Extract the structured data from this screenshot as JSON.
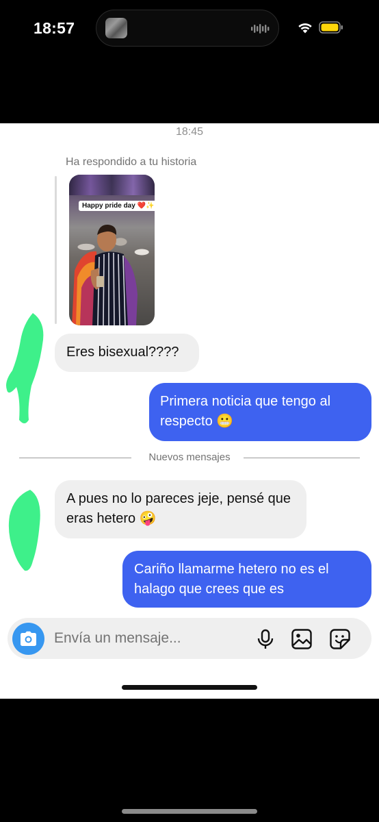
{
  "status_bar": {
    "time": "18:57"
  },
  "chat": {
    "timestamp": "18:45",
    "story_reply": {
      "caption": "Ha respondido a tu historia",
      "sticker_text": "Happy pride day ❤️✨"
    },
    "messages": [
      {
        "direction": "incoming",
        "text": "Eres bisexual????"
      },
      {
        "direction": "outgoing",
        "text": "Primera noticia que tengo al respecto 😬"
      },
      {
        "direction": "incoming",
        "text": "A pues no lo pareces jeje, pensé que eras hetero 🤪"
      },
      {
        "direction": "outgoing",
        "text": "Cariño llamarme hetero no es el halago que crees que es"
      }
    ],
    "new_messages_divider": "Nuevos mensajes"
  },
  "composer": {
    "placeholder": "Envía un mensaje...",
    "icons": [
      "camera-icon",
      "microphone-icon",
      "gallery-icon",
      "sticker-icon"
    ]
  },
  "colors": {
    "outgoing_bubble": "#3e62f0",
    "incoming_bubble": "#efefef",
    "camera_button": "#3797f0",
    "battery": "#ffd60a",
    "scribble": "#3ef08a"
  }
}
